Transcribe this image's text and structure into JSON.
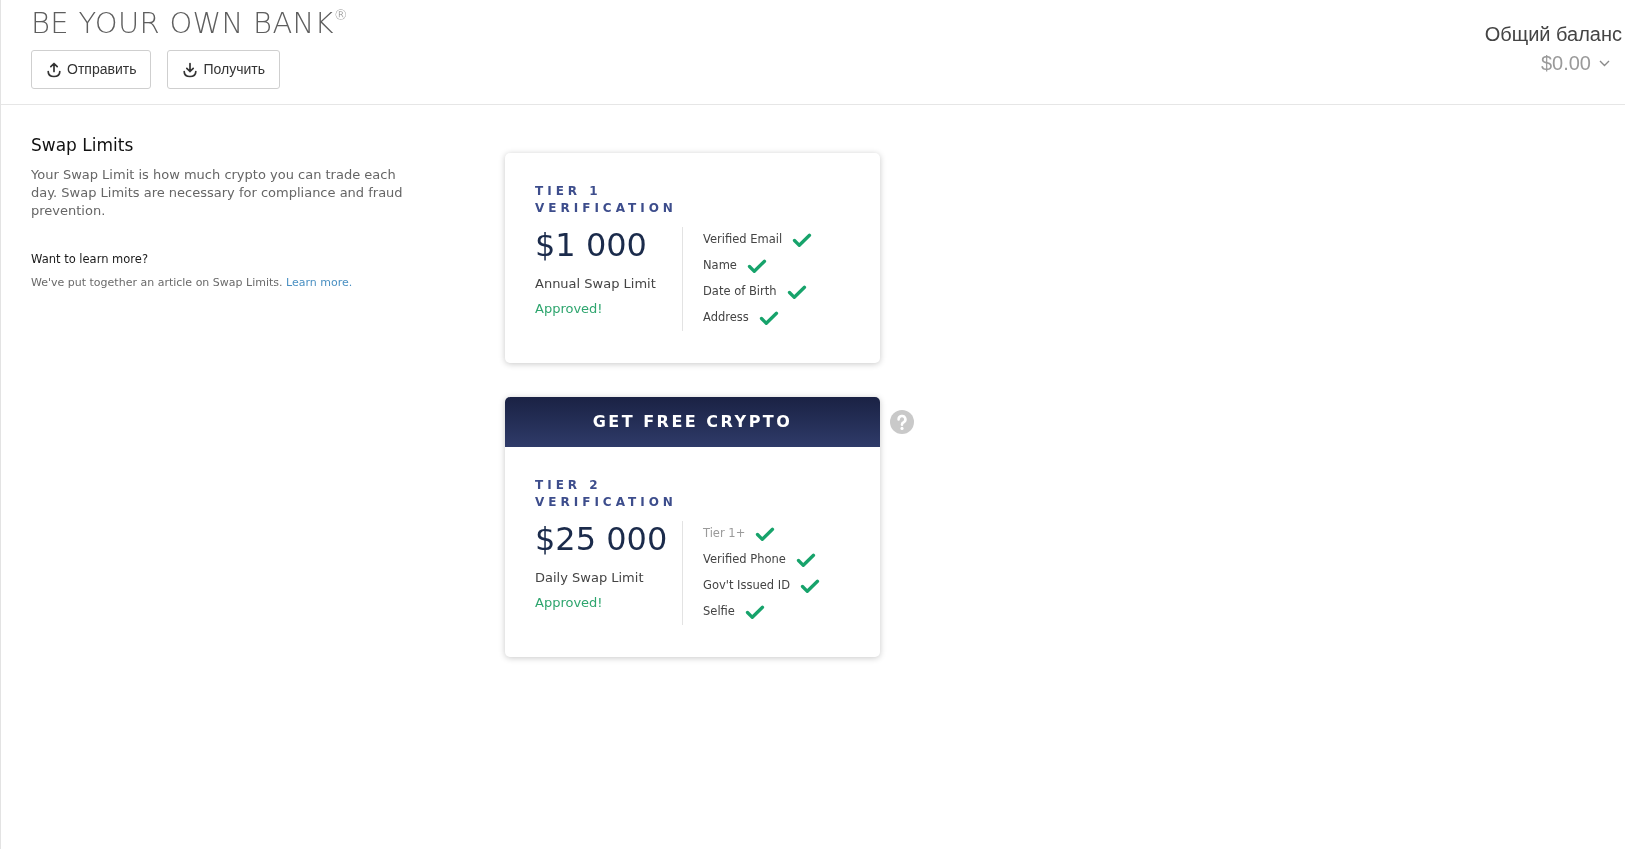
{
  "header": {
    "title": "BE YOUR OWN BANK$^{®}$",
    "buttons": [
      {
        "label": "Отправить",
        "kind": "send"
      },
      {
        "label": "Получить",
        "kind": "receive"
      }
    ],
    "balance": {
      "label": "Общий баланс",
      "value": "$0.00"
    }
  },
  "info": {
    "heading": "Swap Limits",
    "description": "Your Swap Limit is how much crypto you can trade each day. Swap Limits are necessary for compliance and fraud prevention.",
    "learn_heading": "Want to learn more?",
    "learn_text": "We've put together an article on Swap Limits.",
    "learn_link": "Learn more."
  },
  "tiers": [
    {
      "title": "TIER 1 VERIFICATION",
      "amount": "$1 000",
      "period": "Annual Swap Limit",
      "status": "Approved!",
      "approved": true,
      "requirements": [
        {
          "label": "Verified Email",
          "verified": true,
          "muted": false
        },
        {
          "label": "Name",
          "verified": true,
          "muted": false
        },
        {
          "label": "Date of Birth",
          "verified": true,
          "muted": false
        },
        {
          "label": "Address",
          "verified": true,
          "muted": false
        }
      ]
    },
    {
      "banner": "GET FREE CRYPTO",
      "title": "TIER 2 VERIFICATION",
      "amount": "$25 000",
      "period": "Daily Swap Limit",
      "status": "Approved!",
      "approved": true,
      "requirements": [
        {
          "label": "Tier 1+",
          "verified": true,
          "muted": true
        },
        {
          "label": "Verified Phone",
          "verified": true,
          "muted": false
        },
        {
          "label": "Gov't Issued ID",
          "verified": true,
          "muted": false
        },
        {
          "label": "Selfie",
          "verified": true,
          "muted": false
        }
      ]
    }
  ]
}
